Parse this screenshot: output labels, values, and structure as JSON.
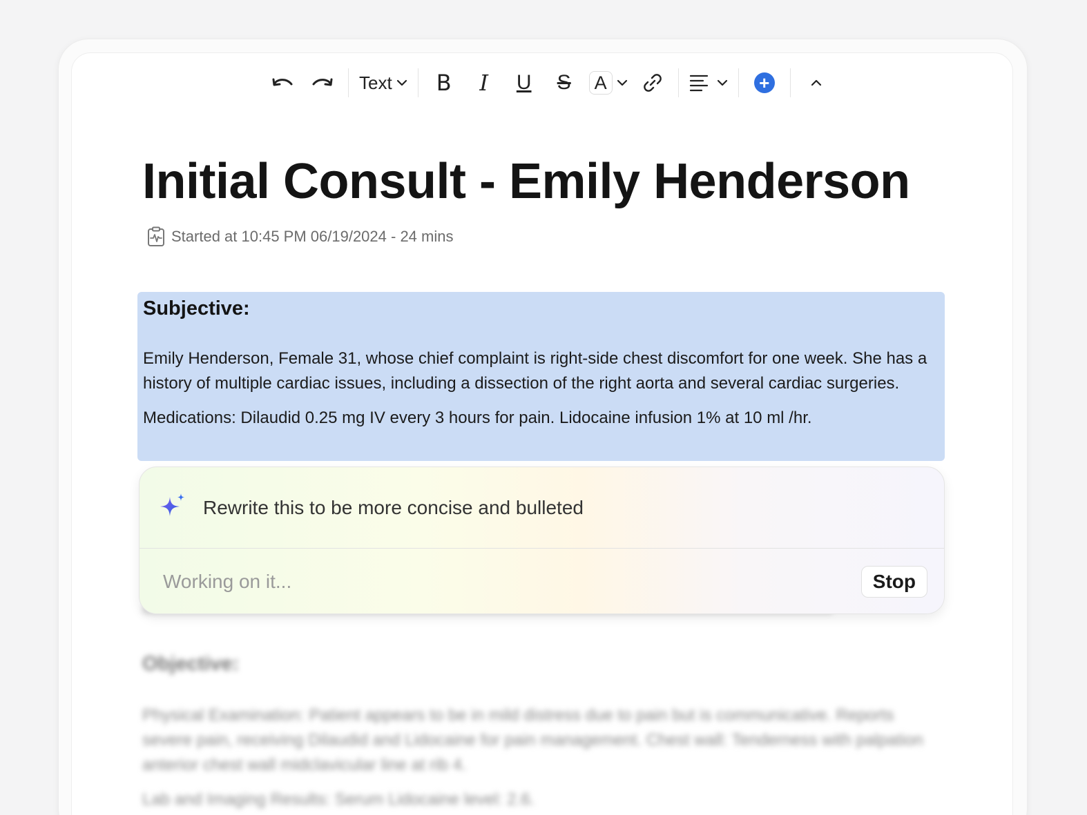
{
  "toolbar": {
    "text_style_label": "Text",
    "bold_label": "B",
    "italic_label": "I",
    "underline_label": "U",
    "strike_label": "S",
    "font_color_label": "A",
    "icons": [
      "undo-icon",
      "redo-icon",
      "chevron-down-icon",
      "link-icon",
      "align-left-icon",
      "plus-circle-icon",
      "chevron-up-icon"
    ],
    "accent_color": "#2f6fe0"
  },
  "document": {
    "title": "Initial Consult - Emily Henderson",
    "meta": "Started at 10:45 PM 06/19/2024 - 24 mins",
    "subjective": {
      "heading": "Subjective:",
      "paragraph1": "Emily Henderson, Female 31, whose chief complaint is right-side chest discomfort for one week. She has a history of multiple cardiac issues, including a dissection of the right aorta and several cardiac surgeries.",
      "paragraph2": "Medications: Dilaudid 0.25 mg IV every 3 hours for pain. Lidocaine infusion 1% at 10 ml /hr.",
      "highlight_color": "#cbdcf5"
    },
    "objective": {
      "heading": "Objective:",
      "paragraph1": "Physical Examination: Patient appears to be in mild distress due to pain but is communicative. Reports severe pain, receiving Dilaudid and Lidocaine for pain management. Chest wall: Tenderness with palpation anterior chest wall midclavicular line at rib 4.",
      "paragraph2": "Lab and Imaging Results: Serum Lidocaine level: 2.6."
    }
  },
  "ai_assistant": {
    "prompt": "Rewrite this to be more concise and bulleted",
    "status": "Working on it...",
    "stop_label": "Stop"
  }
}
